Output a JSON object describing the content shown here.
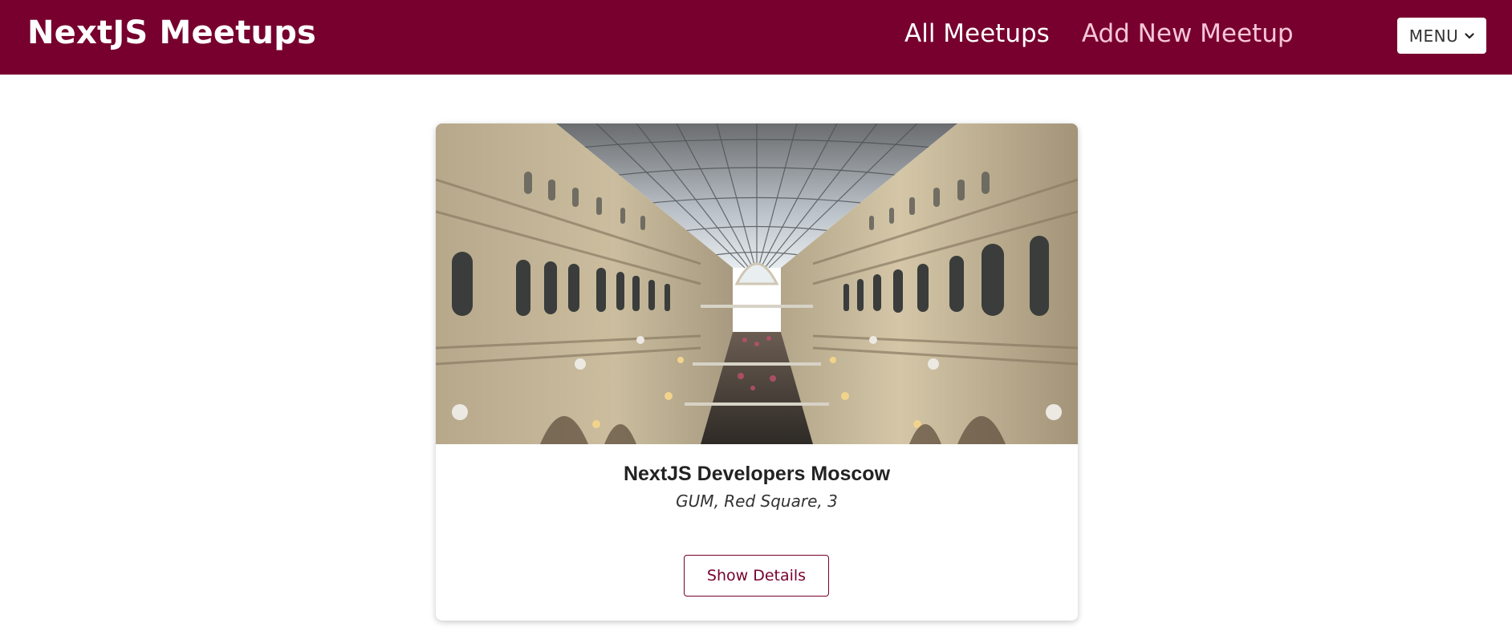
{
  "header": {
    "logo": "NextJS Meetups",
    "nav": [
      {
        "label": "All Meetups",
        "active": true
      },
      {
        "label": "Add New Meetup",
        "active": false
      }
    ],
    "menu_label": "MENU",
    "background_color": "#77002e"
  },
  "meetup": {
    "image_description_icon": "gum-gallery-photo",
    "title": "NextJS Developers Moscow",
    "address": "GUM, Red Square, 3",
    "details_button": "Show Details"
  },
  "colors": {
    "accent": "#77002e",
    "nav_inactive": "#f7c6d7"
  }
}
